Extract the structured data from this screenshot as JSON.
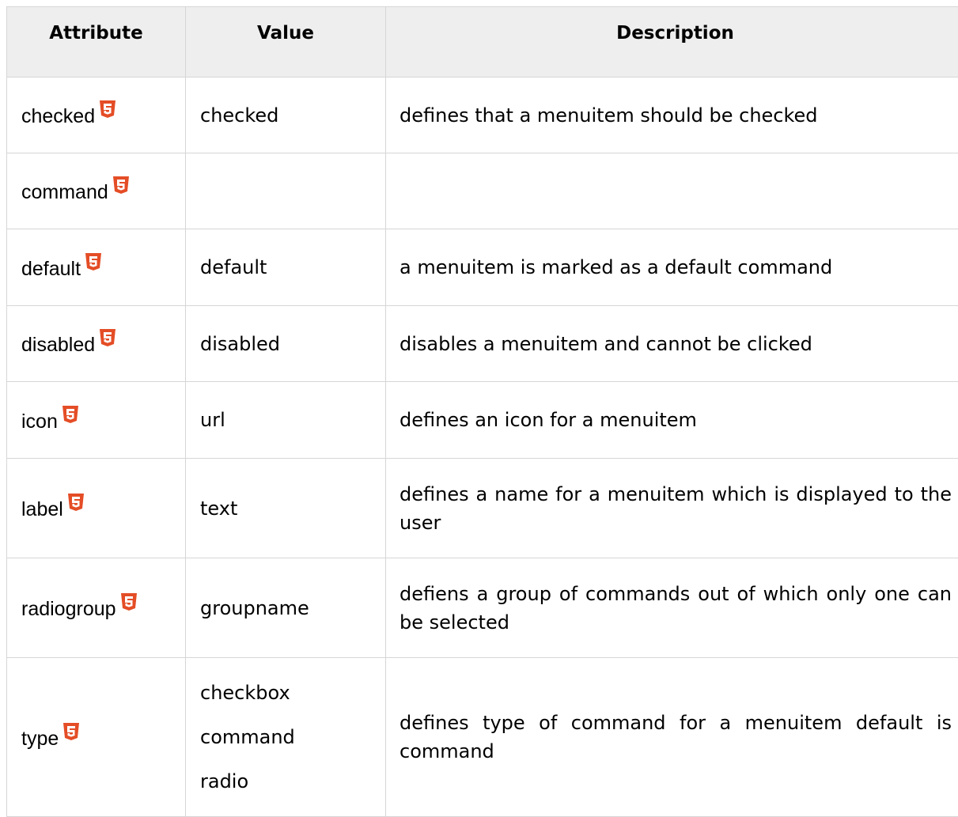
{
  "header": {
    "attribute": "Attribute",
    "value": "Value",
    "description": "Description"
  },
  "colors": {
    "header_bg": "#eeeeee",
    "border": "#d6d6d6",
    "html5_badge": "#e44d26"
  },
  "rows": [
    {
      "attribute": "checked",
      "value": "checked",
      "description": "defines that a menuitem should be checked",
      "icon": "html5-icon"
    },
    {
      "attribute": "command",
      "value": "",
      "description": "",
      "icon": "html5-icon"
    },
    {
      "attribute": "default",
      "value": "default",
      "description": "a menuitem is marked as a default command",
      "icon": "html5-icon"
    },
    {
      "attribute": "disabled",
      "value": "disabled",
      "description": "disables a menuitem and cannot be clicked",
      "icon": "html5-icon"
    },
    {
      "attribute": "icon",
      "value": "url",
      "description": "defines an icon for a menuitem",
      "icon": "html5-icon"
    },
    {
      "attribute": "label",
      "value": "text",
      "description": "defines a name for a menuitem which is displayed to the user",
      "icon": "html5-icon"
    },
    {
      "attribute": "radiogroup",
      "value": "groupname",
      "description": "defiens a group of commands out of which only one can be selected",
      "icon": "html5-icon"
    },
    {
      "attribute": "type",
      "values": [
        "checkbox",
        "command",
        "radio"
      ],
      "description": "defines type of command for a menuitem default is command",
      "icon": "html5-icon"
    }
  ]
}
